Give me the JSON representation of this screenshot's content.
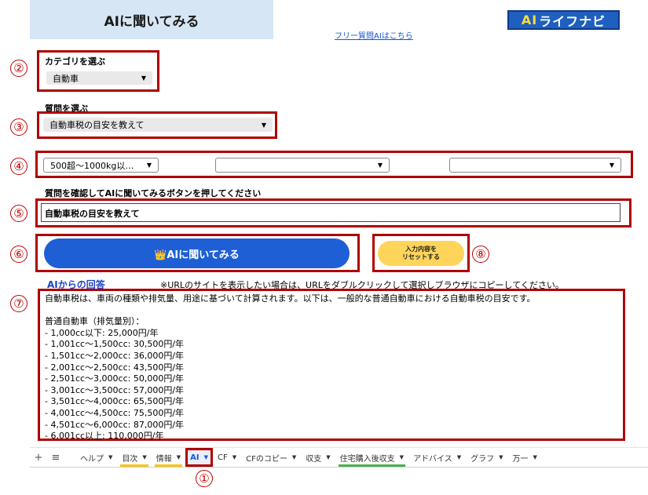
{
  "header": {
    "title": "AIに聞いてみる",
    "free_link": "フリー質問AIはこちら",
    "logo_ai": "AI",
    "logo_rest": "ライフナビ"
  },
  "callouts": {
    "n1": "①",
    "n2": "②",
    "n3": "③",
    "n4": "④",
    "n5": "⑤",
    "n6": "⑥",
    "n7": "⑦",
    "n8": "⑧"
  },
  "category": {
    "label": "カテゴリを選ぶ",
    "value": "自動車"
  },
  "question": {
    "label": "質問を選ぶ",
    "value": "自動車税の目安を教えて"
  },
  "options": {
    "option1": "500超～1000kg以…",
    "option2": "",
    "option3": ""
  },
  "confirm": {
    "label": "質問を確認してAIに聞いてみるボタンを押してください",
    "value": "自動車税の目安を教えて"
  },
  "buttons": {
    "ask_label": "👑AIに聞いてみる",
    "reset_line1": "入力内容を",
    "reset_line2": "リセットする"
  },
  "answer": {
    "title": "AIからの回答",
    "note": "※URLのサイトを表示したい場合は、URLをダブルクリックして選択しブラウザにコピーしてください。",
    "text": "自動車税は、車両の種類や排気量、用途に基づいて計算されます。以下は、一般的な普通自動車における自動車税の目安です。\n\n普通自動車（排気量別）：\n- 1,000cc以下: 25,000円/年\n- 1,001cc～1,500cc: 30,500円/年\n- 1,501cc～2,000cc: 36,000円/年\n- 2,001cc～2,500cc: 43,500円/年\n- 2,501cc～3,000cc: 50,000円/年\n- 3,001cc～3,500cc: 57,000円/年\n- 3,501cc～4,000cc: 65,500円/年\n- 4,001cc～4,500cc: 75,500円/年\n- 4,501cc～6,000cc: 87,000円/年\n- 6,001cc以上: 110,000円/年"
  },
  "tabs": {
    "add": "+",
    "menu": "≡",
    "items": [
      {
        "label": "ヘルプ",
        "accent": "none"
      },
      {
        "label": "目次",
        "accent": "yellow"
      },
      {
        "label": "情報",
        "accent": "yellow"
      },
      {
        "label": "AI",
        "accent": "active"
      },
      {
        "label": "CF",
        "accent": "none"
      },
      {
        "label": "CFのコピー",
        "accent": "none"
      },
      {
        "label": "収支",
        "accent": "none"
      },
      {
        "label": "住宅購入後収支",
        "accent": "green"
      },
      {
        "label": "アドバイス",
        "accent": "none"
      },
      {
        "label": "グラフ",
        "accent": "none"
      },
      {
        "label": "万一",
        "accent": "none"
      }
    ]
  },
  "colors": {
    "callout_red": "#b00000",
    "ask_button": "#1e5fd6",
    "reset_button": "#ffd45a",
    "title_bg": "#d6e6f5",
    "logo_bg": "#1f5fbf"
  }
}
